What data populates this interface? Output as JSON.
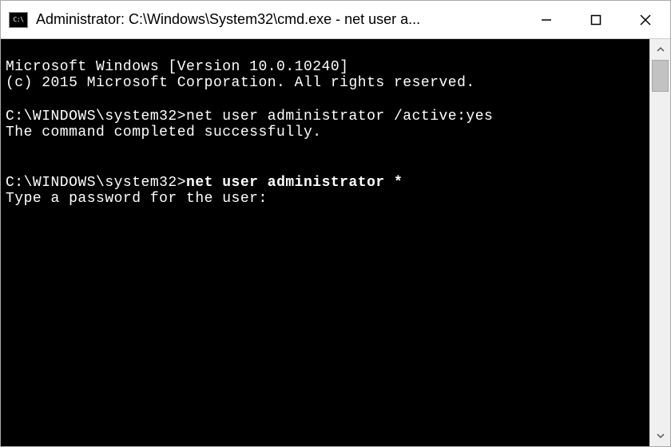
{
  "titlebar": {
    "icon_label": "C:\\",
    "title": "Administrator: C:\\Windows\\System32\\cmd.exe - net  user a..."
  },
  "console": {
    "line1": "Microsoft Windows [Version 10.0.10240]",
    "line2": "(c) 2015 Microsoft Corporation. All rights reserved.",
    "blank1": " ",
    "prompt1": "C:\\WINDOWS\\system32>",
    "cmd1": "net user administrator /active:yes",
    "result1": "The command completed successfully.",
    "blank2": " ",
    "blank3": " ",
    "prompt2": "C:\\WINDOWS\\system32>",
    "cmd2": "net user administrator *",
    "line_pw": "Type a password for the user:"
  }
}
